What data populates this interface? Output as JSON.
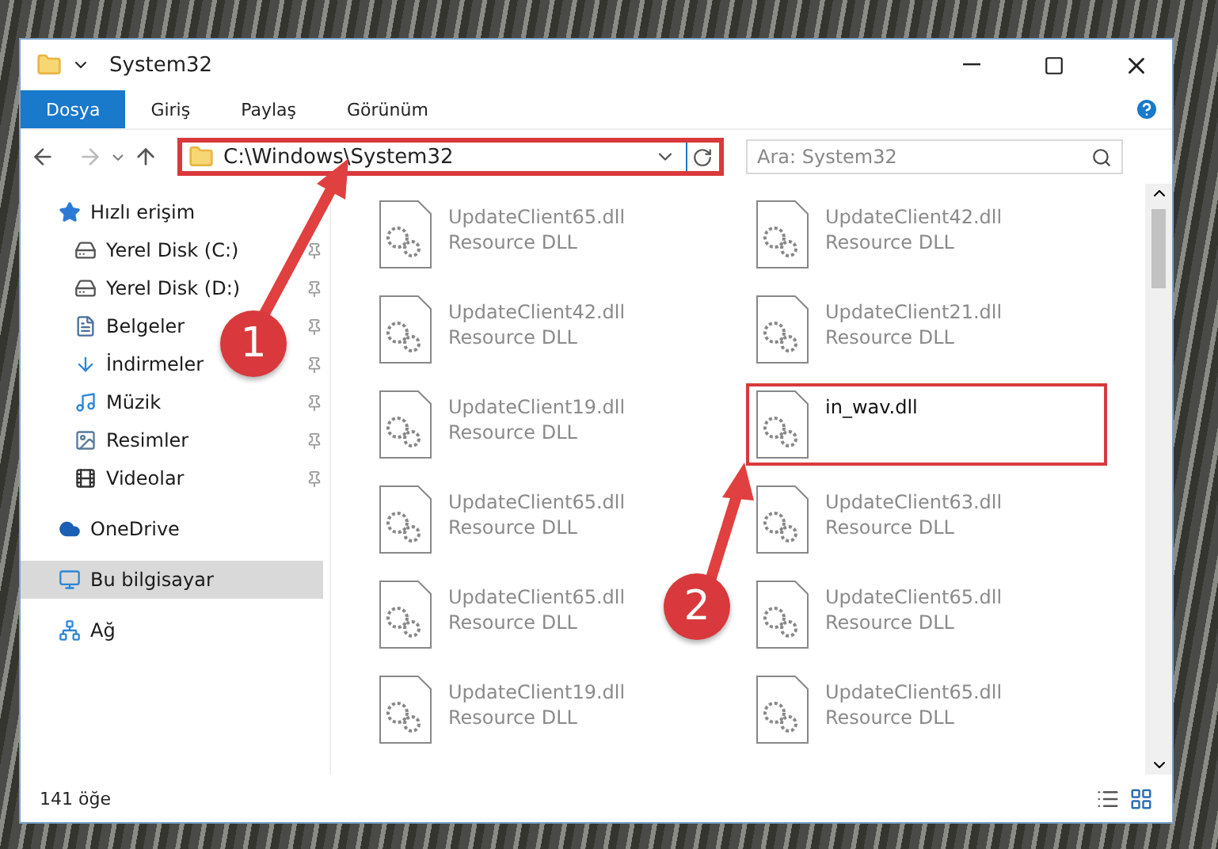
{
  "window": {
    "title": "System32"
  },
  "ribbon_tabs": [
    {
      "label": "Dosya",
      "selected": true
    },
    {
      "label": "Giriş",
      "selected": false
    },
    {
      "label": "Paylaş",
      "selected": false
    },
    {
      "label": "Görünüm",
      "selected": false
    }
  ],
  "address": {
    "path": "C:\\Windows\\System32",
    "highlighted": true
  },
  "search": {
    "placeholder": "Ara: System32"
  },
  "sidebar": {
    "items": [
      {
        "label": "Hızlı erişim",
        "kind": "star",
        "selected": false,
        "children": [
          {
            "label": "Yerel Disk (C:)",
            "kind": "disk-c",
            "selected": false,
            "pinned": true
          },
          {
            "label": "Yerel Disk (D:)",
            "kind": "disk",
            "selected": false,
            "pinned": true
          },
          {
            "label": "Belgeler",
            "kind": "docs",
            "selected": false,
            "pinned": true
          },
          {
            "label": "İndirmeler",
            "kind": "download",
            "selected": false,
            "pinned": true
          },
          {
            "label": "Müzik",
            "kind": "music",
            "selected": false,
            "pinned": true
          },
          {
            "label": "Resimler",
            "kind": "pictures",
            "selected": false,
            "pinned": true
          },
          {
            "label": "Videolar",
            "kind": "videos",
            "selected": false,
            "pinned": true
          }
        ]
      },
      {
        "label": "OneDrive",
        "kind": "cloud",
        "selected": false
      },
      {
        "label": "Bu bilgisayar",
        "kind": "pc",
        "selected": true
      },
      {
        "label": "Ağ",
        "kind": "network",
        "selected": false
      }
    ]
  },
  "files": [
    {
      "name": "UpdateClient65.dll",
      "type": "Resource DLL",
      "blurred": true,
      "highlighted": false
    },
    {
      "name": "UpdateClient42.dll",
      "type": "Resource DLL",
      "blurred": true,
      "highlighted": false
    },
    {
      "name": "UpdateClient42.dll",
      "type": "Resource DLL",
      "blurred": true,
      "highlighted": false
    },
    {
      "name": "UpdateClient21.dll",
      "type": "Resource DLL",
      "blurred": true,
      "highlighted": false
    },
    {
      "name": "UpdateClient19.dll",
      "type": "Resource DLL",
      "blurred": true,
      "highlighted": false
    },
    {
      "name": "in_wav.dll",
      "blurred": false,
      "highlighted": true
    },
    {
      "name": "UpdateClient65.dll",
      "type": "Resource DLL",
      "blurred": true,
      "highlighted": false
    },
    {
      "name": "UpdateClient63.dll",
      "type": "Resource DLL",
      "blurred": true,
      "highlighted": false
    },
    {
      "name": "UpdateClient65.dll",
      "type": "Resource DLL",
      "blurred": true,
      "highlighted": false
    },
    {
      "name": "UpdateClient65.dll",
      "type": "Resource DLL",
      "blurred": true,
      "highlighted": false
    },
    {
      "name": "UpdateClient19.dll",
      "type": "Resource DLL",
      "blurred": true,
      "highlighted": false
    },
    {
      "name": "UpdateClient65.dll",
      "type": "Resource DLL",
      "blurred": true,
      "highlighted": false
    }
  ],
  "status_bar": {
    "count": "141 öğe"
  },
  "annotations": [
    {
      "label": "1"
    },
    {
      "label": "2"
    }
  ]
}
